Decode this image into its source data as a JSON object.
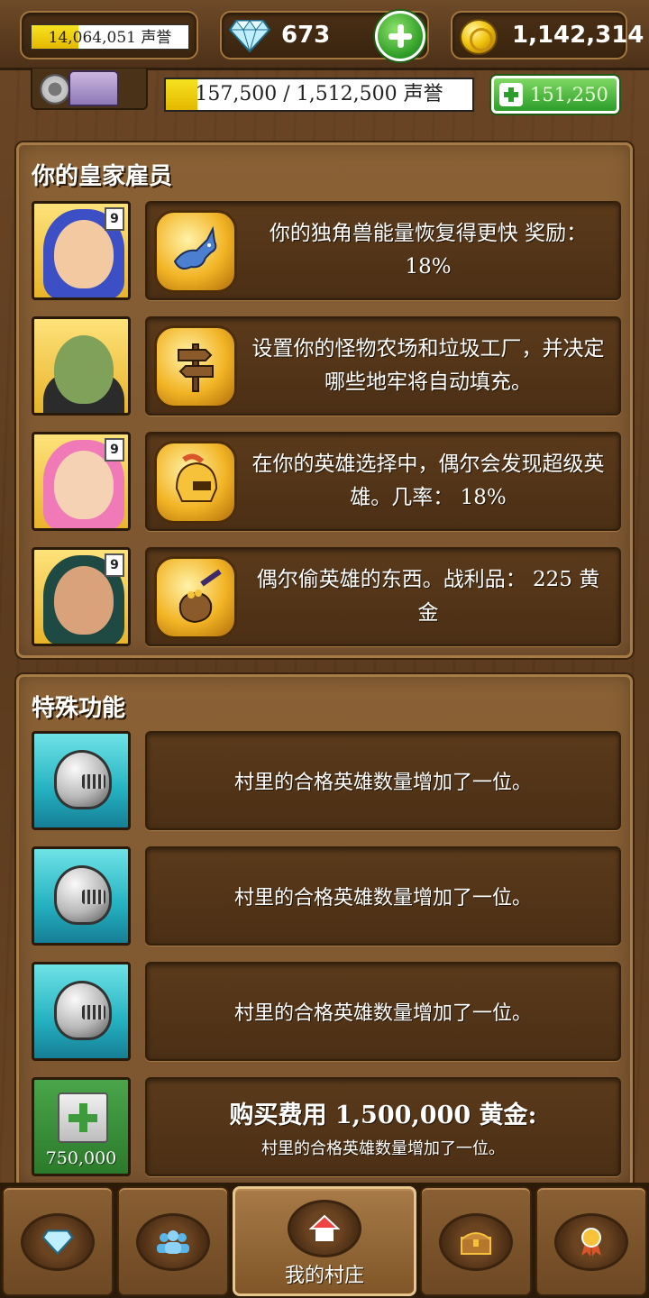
{
  "topbar": {
    "reputation": "14,064,051 声誉",
    "reputation_progress": 0.3,
    "gems": "673",
    "gold": "1,142,314"
  },
  "level": {
    "progress_text": "157,500 / 1,512,500 声誉",
    "progress_fraction": 0.104,
    "upgrade_cost": "151,250"
  },
  "royal_staff": {
    "title": "你的皇家雇员",
    "members": [
      {
        "level": "9",
        "icon": "unicorn-icon",
        "desc": "你的独角兽能量恢复得更快 奖励： 18%"
      },
      {
        "level": "",
        "icon": "signpost-icon",
        "desc": "设置你的怪物农场和垃圾工厂，并决定哪些地牢将自动填充。"
      },
      {
        "level": "9",
        "icon": "golden-helmet-icon",
        "desc": "在你的英雄选择中，偶尔会发现超级英雄。几率： 18%"
      },
      {
        "level": "9",
        "icon": "loot-bag-icon",
        "desc": "偶尔偷英雄的东西。战利品： 225 黄金"
      }
    ]
  },
  "special": {
    "title": "特殊功能",
    "features": [
      {
        "desc": "村里的合格英雄数量增加了一位。"
      },
      {
        "desc": "村里的合格英雄数量增加了一位。"
      },
      {
        "desc": "村里的合格英雄数量增加了一位。"
      }
    ],
    "buy": {
      "price": "750,000",
      "title": "购买费用 1,500,000 黄金:",
      "desc": "村里的合格英雄数量增加了一位。"
    }
  },
  "nav": {
    "items": [
      {
        "icon": "gem-icon",
        "label": ""
      },
      {
        "icon": "people-icon",
        "label": ""
      },
      {
        "icon": "house-icon",
        "label": "我的村庄"
      },
      {
        "icon": "chest-icon",
        "label": ""
      },
      {
        "icon": "medal-icon",
        "label": ""
      }
    ]
  },
  "colors": {
    "wood": "#7a5430",
    "dark_card": "#4b2f15",
    "gold_badge": "#f2b425",
    "teal_badge": "#24b1c1",
    "green": "#2c9d2a"
  }
}
